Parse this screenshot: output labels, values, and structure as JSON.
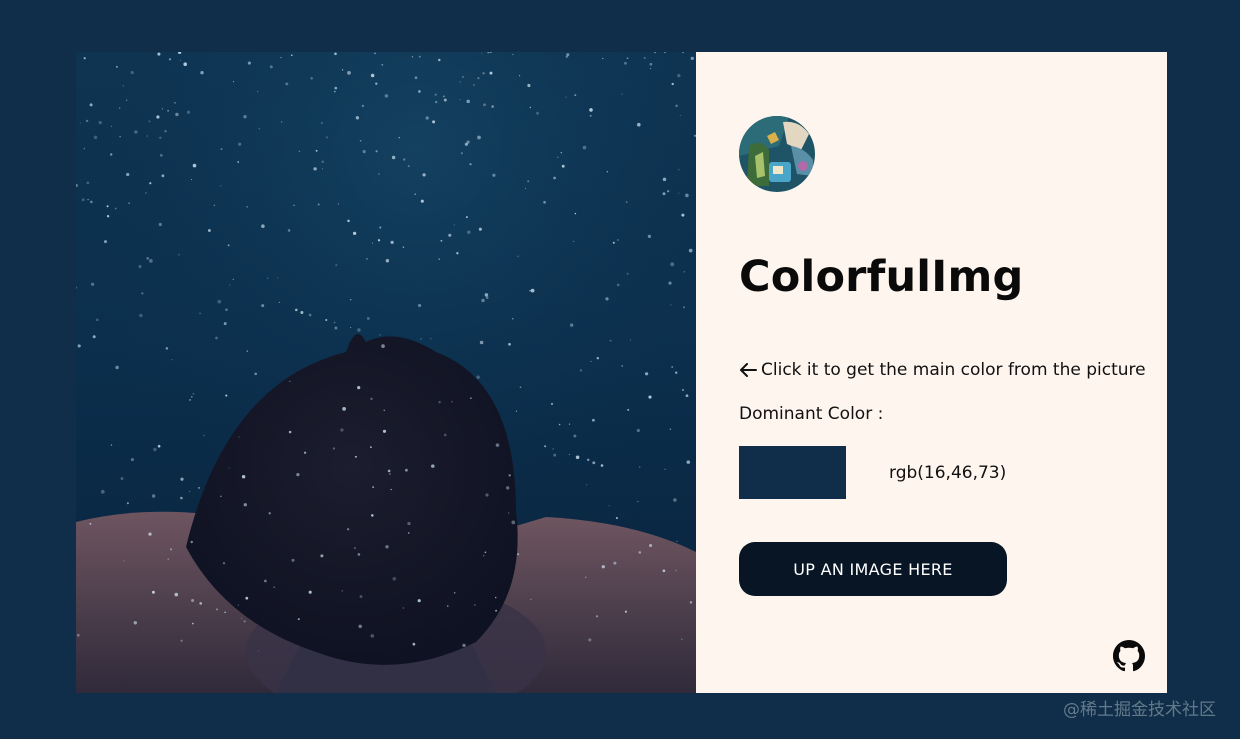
{
  "app": {
    "title": "ColorfulImg",
    "hint_text": "Click it to get the main color from the picture",
    "dominant_label": "Dominant Color :",
    "dominant_rgb": "rgb(16,46,73)",
    "dominant_hex": "#102e49",
    "upload_button_label": "UP AN IMAGE HERE"
  },
  "icons": {
    "hint_arrow": "arrow-left-icon",
    "repo_link": "github-icon"
  },
  "colors": {
    "page_background": "#102e49",
    "panel_background": "#fdf5ee",
    "button_background": "#081525",
    "button_text": "#ffffff"
  },
  "watermark": "@稀土掘金技术社区"
}
